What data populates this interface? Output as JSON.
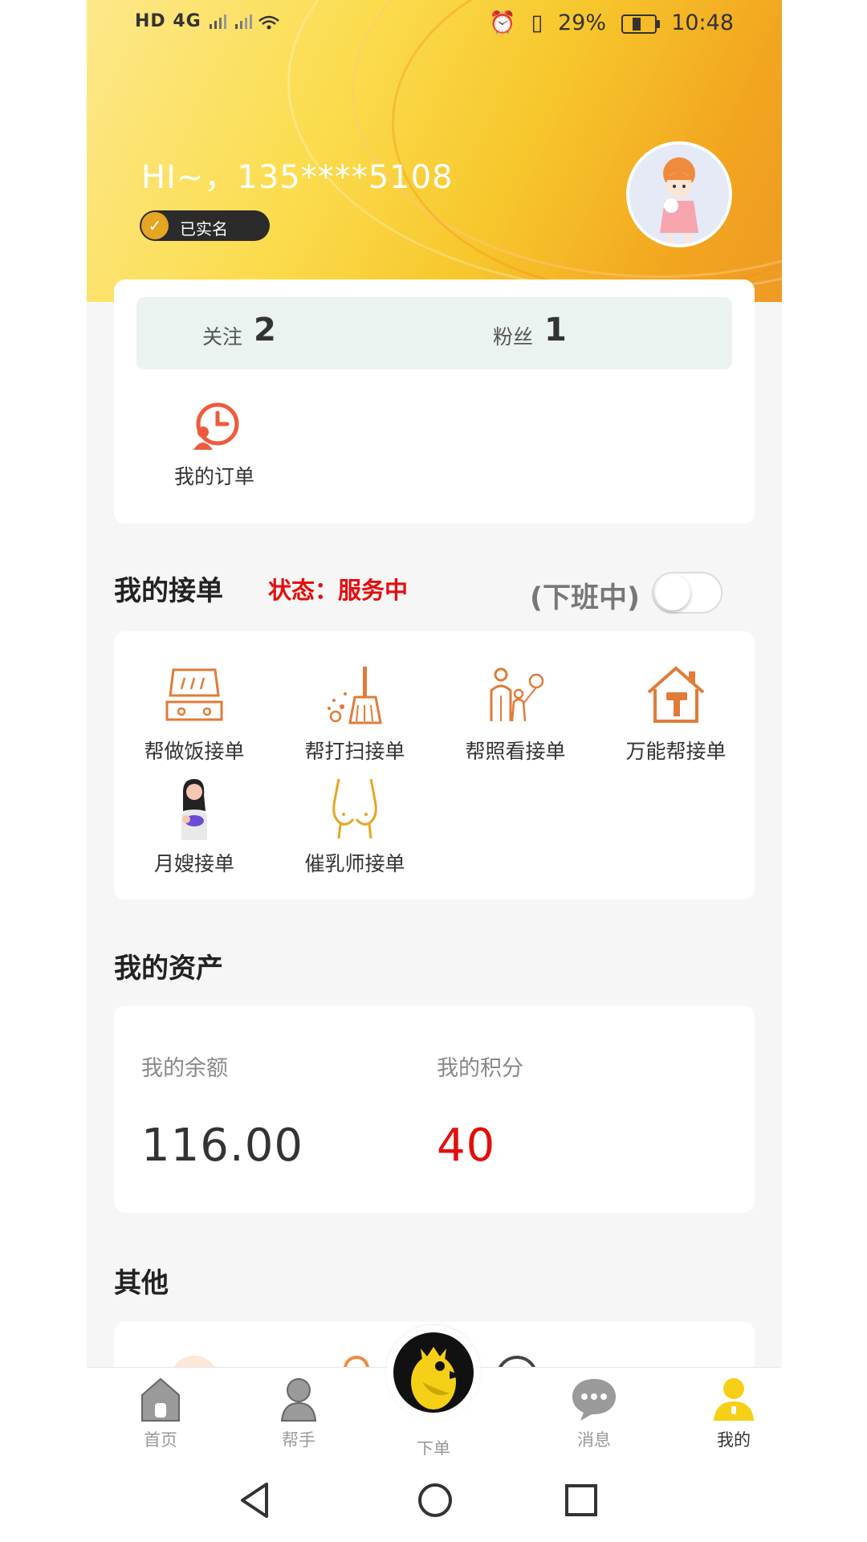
{
  "status_bar": {
    "network": "HD 4G",
    "battery_percent": "29%",
    "battery_level": 0.29,
    "time": "10:48"
  },
  "profile": {
    "greeting": "HI~，135****5108",
    "verified_label": "已实名"
  },
  "follow": {
    "following_label": "关注",
    "following_count": "2",
    "fans_label": "粉丝",
    "fans_count": "1"
  },
  "orders": {
    "my_orders_label": "我的订单"
  },
  "accept_orders": {
    "title": "我的接单",
    "status": "状态：服务中",
    "off_duty": "(下班中)",
    "toggle_on": false,
    "services": [
      {
        "label": "帮做饭接单",
        "icon": "cooktop-icon"
      },
      {
        "label": "帮打扫接单",
        "icon": "broom-icon"
      },
      {
        "label": "帮照看接单",
        "icon": "family-care-icon"
      },
      {
        "label": "万能帮接单",
        "icon": "house-hammer-icon"
      },
      {
        "label": "月嫂接单",
        "icon": "nanny-icon"
      },
      {
        "label": "催乳师接单",
        "icon": "lactation-icon"
      }
    ]
  },
  "assets": {
    "title": "我的资产",
    "balance_label": "我的余额",
    "balance_value": "116.00",
    "points_label": "我的积分",
    "points_value": "40",
    "points_color": "#e60c0c"
  },
  "other": {
    "title": "其他"
  },
  "tabbar": {
    "home": "首页",
    "helper": "帮手",
    "order": "下单",
    "messages": "消息",
    "mine": "我的",
    "active_color": "#f5c518"
  },
  "colors": {
    "accent_red": "#e60c0c",
    "service_icon": "#e07b39",
    "header_yellow": "#f7c72d"
  }
}
